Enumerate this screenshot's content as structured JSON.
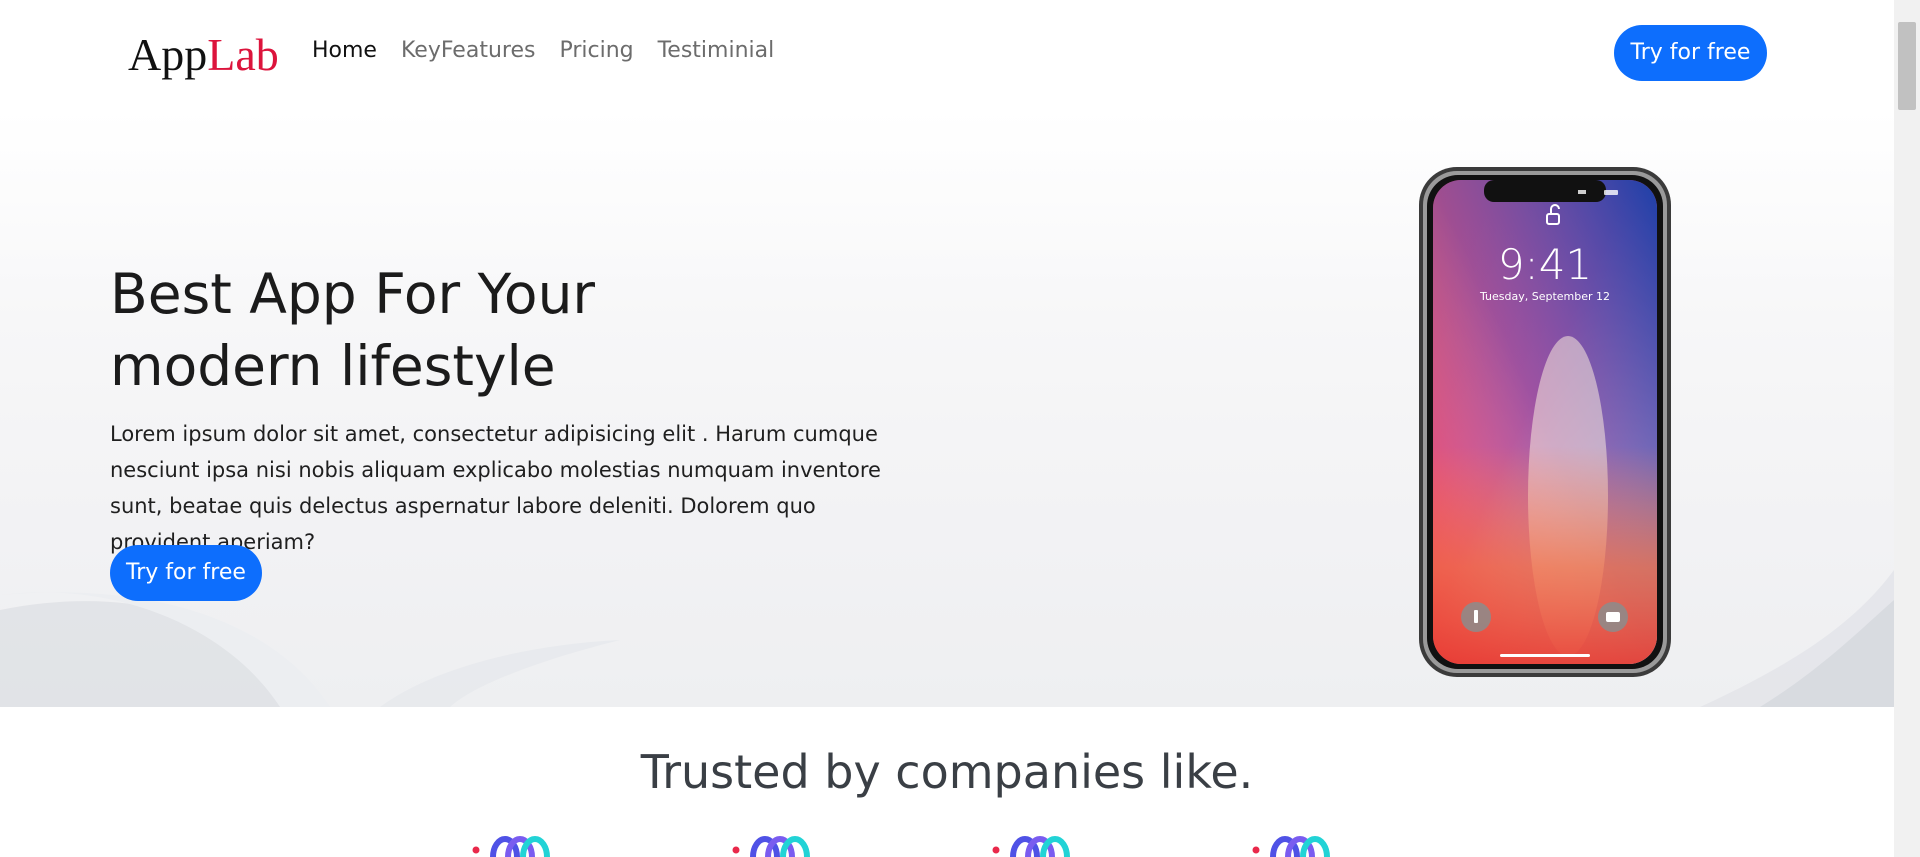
{
  "brand": {
    "part1": "App",
    "part2": "Lab",
    "accent_color": "#dc143c"
  },
  "nav": {
    "items": [
      {
        "label": "Home",
        "active": true
      },
      {
        "label": "KeyFeatures",
        "active": false
      },
      {
        "label": "Pricing",
        "active": false
      },
      {
        "label": "Testiminial",
        "active": false
      }
    ],
    "cta_label": "Try for free"
  },
  "hero": {
    "title_line1": "Best App For Your",
    "title_line2": "modern lifestyle",
    "text": "Lorem ipsum dolor sit amet, consectetur adipisicing elit . Harum cumque nesciunt ipsa nisi nobis aliquam explicabo molestias numquam inventore sunt, beatae quis delectus aspernatur labore deleniti. Dolorem quo provident aperiam?",
    "cta_label": "Try for free"
  },
  "phone": {
    "time": "9:41",
    "date": "Tuesday, September 12"
  },
  "trusted": {
    "title": "Trusted by companies like."
  },
  "colors": {
    "primary": "#0d6efd",
    "text_dark": "#1b1b1b",
    "heading_gray": "#3a3f45"
  }
}
